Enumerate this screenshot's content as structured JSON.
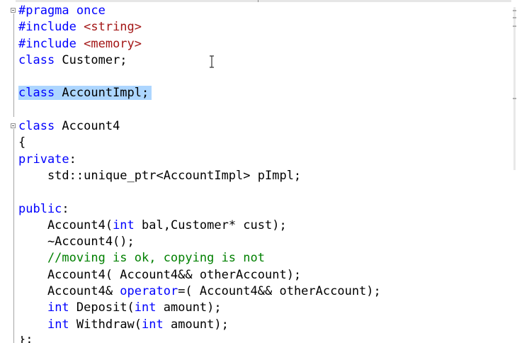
{
  "editor": {
    "lines": [
      {
        "segments": [
          {
            "text": "#pragma ",
            "cls": "kw"
          },
          {
            "text": "once",
            "cls": "kw"
          }
        ]
      },
      {
        "segments": [
          {
            "text": "#include ",
            "cls": "kw"
          },
          {
            "text": "<string>",
            "cls": "str"
          }
        ]
      },
      {
        "segments": [
          {
            "text": "#include ",
            "cls": "kw"
          },
          {
            "text": "<memory>",
            "cls": "str"
          }
        ]
      },
      {
        "segments": [
          {
            "text": "class",
            "cls": "kw"
          },
          {
            "text": " Customer;",
            "cls": ""
          }
        ]
      },
      {
        "segments": []
      },
      {
        "highlight": true,
        "segments": [
          {
            "text": "class",
            "cls": "kw"
          },
          {
            "text": " AccountImpl;",
            "cls": ""
          }
        ]
      },
      {
        "segments": []
      },
      {
        "segments": [
          {
            "text": "class",
            "cls": "kw"
          },
          {
            "text": " Account4",
            "cls": ""
          }
        ]
      },
      {
        "segments": [
          {
            "text": "{",
            "cls": ""
          }
        ]
      },
      {
        "segments": [
          {
            "text": "private",
            "cls": "kw"
          },
          {
            "text": ":",
            "cls": ""
          }
        ]
      },
      {
        "segments": [
          {
            "text": "    std::unique_ptr<AccountImpl> pImpl;",
            "cls": ""
          }
        ]
      },
      {
        "segments": []
      },
      {
        "segments": [
          {
            "text": "public",
            "cls": "kw"
          },
          {
            "text": ":",
            "cls": ""
          }
        ]
      },
      {
        "segments": [
          {
            "text": "    Account4(",
            "cls": ""
          },
          {
            "text": "int",
            "cls": "kw"
          },
          {
            "text": " bal,Customer* cust);",
            "cls": ""
          }
        ]
      },
      {
        "segments": [
          {
            "text": "    ~Account4();",
            "cls": ""
          }
        ]
      },
      {
        "segments": [
          {
            "text": "    //moving is ok, copying is not",
            "cls": "cm"
          }
        ]
      },
      {
        "segments": [
          {
            "text": "    Account4( Account4&& otherAccount);",
            "cls": ""
          }
        ]
      },
      {
        "segments": [
          {
            "text": "    Account4& ",
            "cls": ""
          },
          {
            "text": "operator",
            "cls": "kw"
          },
          {
            "text": "=( Account4&& otherAccount);",
            "cls": ""
          }
        ]
      },
      {
        "segments": [
          {
            "text": "    ",
            "cls": ""
          },
          {
            "text": "int",
            "cls": "kw"
          },
          {
            "text": " Deposit(",
            "cls": ""
          },
          {
            "text": "int",
            "cls": "kw"
          },
          {
            "text": " amount);",
            "cls": ""
          }
        ]
      },
      {
        "segments": [
          {
            "text": "    ",
            "cls": ""
          },
          {
            "text": "int",
            "cls": "kw"
          },
          {
            "text": " Withdraw(",
            "cls": ""
          },
          {
            "text": "int",
            "cls": "kw"
          },
          {
            "text": " amount);",
            "cls": ""
          }
        ]
      }
    ],
    "partial_last_line": "};"
  }
}
